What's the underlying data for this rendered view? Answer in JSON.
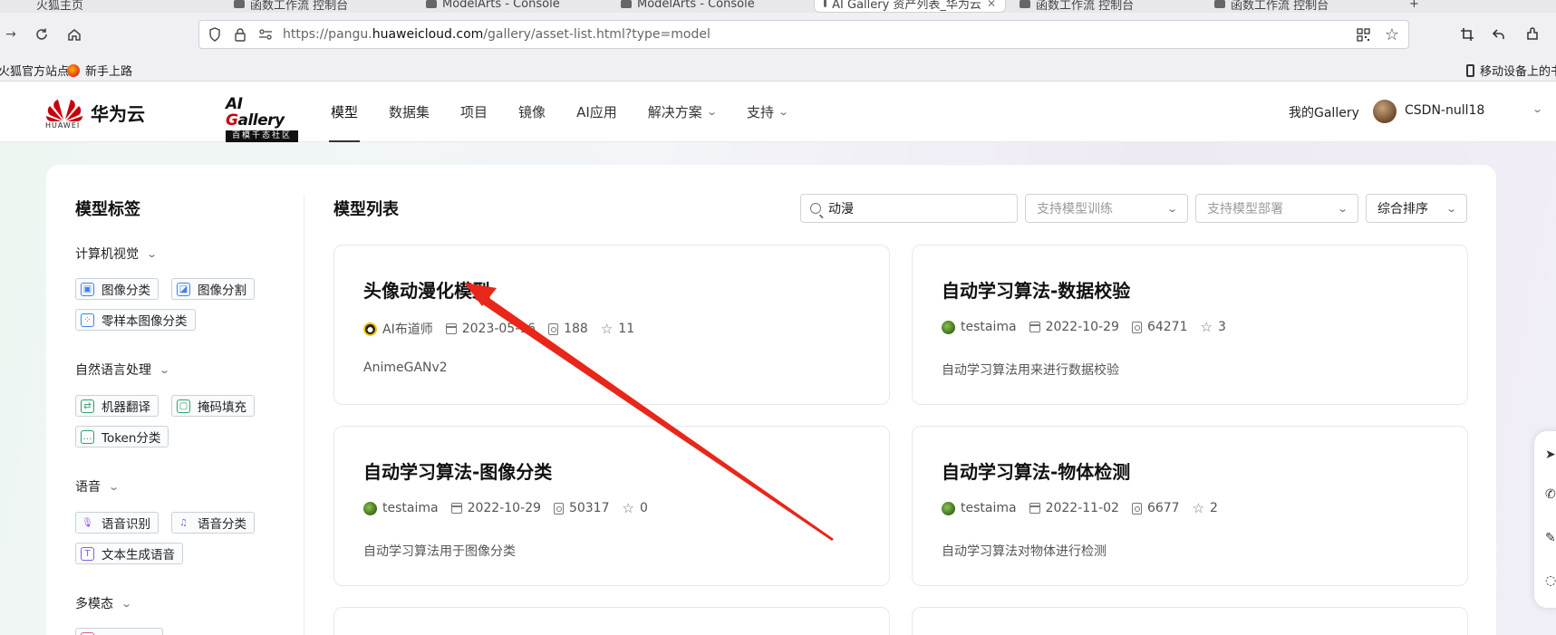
{
  "browser": {
    "tabs": [
      {
        "label": "火狐主页"
      },
      {
        "label": "函数工作流 控制台"
      },
      {
        "label": "ModelArts - Console"
      },
      {
        "label": "ModelArts - Console"
      },
      {
        "label": "AI Gallery 资产列表_华为云"
      },
      {
        "label": "函数工作流 控制台"
      },
      {
        "label": "函数工作流 控制台"
      }
    ],
    "new_tab": "+",
    "url_prefix": "https://pangu.",
    "url_domain": "huaweicloud.com",
    "url_path": "/gallery/asset-list.html?type=model",
    "bookmarks": {
      "firefox_official": "火狐官方站点",
      "beginners": "新手上路",
      "mobile": "移动设备上的书签"
    }
  },
  "header": {
    "brand_name": "华为云",
    "brand_en": "HUAWEI",
    "gallery_title_a": "AI ",
    "gallery_title_b": "G",
    "gallery_title_c": "allery",
    "gallery_sub": "百模千态社区",
    "nav": [
      {
        "label": "模型"
      },
      {
        "label": "数据集"
      },
      {
        "label": "项目"
      },
      {
        "label": "镜像"
      },
      {
        "label": "AI应用"
      },
      {
        "label": "解决方案"
      },
      {
        "label": "支持"
      }
    ],
    "my_gallery": "我的Gallery",
    "username": "CSDN-null18"
  },
  "sidebar": {
    "title": "模型标签",
    "categories": [
      {
        "label": "计算机视觉",
        "tags": [
          "图像分类",
          "图像分割",
          "零样本图像分类"
        ]
      },
      {
        "label": "自然语言处理",
        "tags": [
          "机器翻译",
          "掩码填充",
          "Token分类"
        ]
      },
      {
        "label": "语音",
        "tags": [
          "语音识别",
          "语音分类",
          "文本生成语音"
        ]
      },
      {
        "label": "多模态",
        "tags": [
          "…"
        ]
      }
    ]
  },
  "list": {
    "title": "模型列表",
    "search_value": "动漫",
    "filter_train": "支持模型训练",
    "filter_deploy": "支持模型部署",
    "sort": "综合排序",
    "cards": [
      {
        "title": "头像动漫化模型",
        "author": "AI布道师",
        "date": "2023-05-16",
        "views": "188",
        "stars": "11",
        "desc": "AnimeGANv2"
      },
      {
        "title": "自动学习算法-数据校验",
        "author": "testaima",
        "date": "2022-10-29",
        "views": "64271",
        "stars": "3",
        "desc": "自动学习算法用来进行数据校验"
      },
      {
        "title": "自动学习算法-图像分类",
        "author": "testaima",
        "date": "2022-10-29",
        "views": "50317",
        "stars": "0",
        "desc": "自动学习算法用于图像分类"
      },
      {
        "title": "自动学习算法-物体检测",
        "author": "testaima",
        "date": "2022-11-02",
        "views": "6677",
        "stars": "2",
        "desc": "自动学习算法对物体进行检测"
      }
    ]
  },
  "colors": {
    "accent": "#c7000b",
    "annotation": "#e8261a"
  }
}
